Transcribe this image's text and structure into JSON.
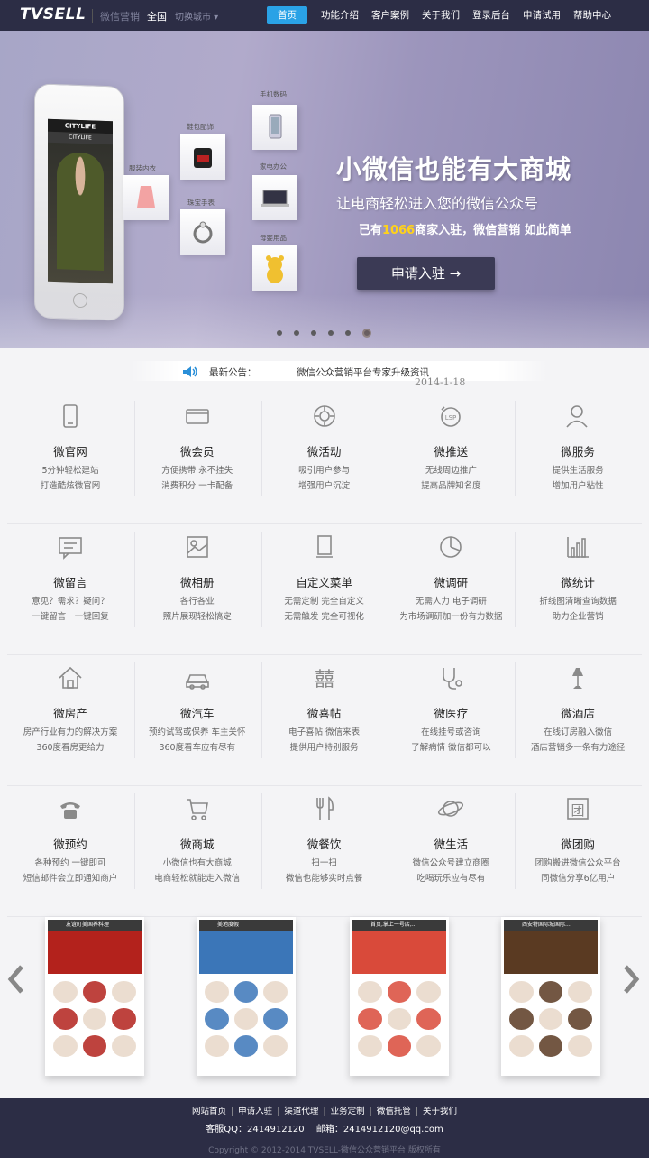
{
  "nav": {
    "logo": "TVSELL",
    "logo_sub": "微信营销",
    "city": "全国",
    "city_switch": "切换城市 ▾",
    "links": [
      "首页",
      "功能介绍",
      "客户案例",
      "关于我们",
      "登录后台",
      "申请试用",
      "帮助中心"
    ],
    "active_index": 0,
    "active_color": "#2aa2e6"
  },
  "banner": {
    "title": "小微信也能有大商城",
    "subtitle": "让电商轻松进入您的微信公众号",
    "line_prefix": "已有",
    "line_count": "1066",
    "line_suffix": "商家入驻，微信营销 如此简单",
    "cta": "申请入驻 →",
    "phone_title": "CITYLIFE",
    "categories": [
      "手机数码",
      "鞋包配饰",
      "服装内衣",
      "家电办公",
      "珠宝手表",
      "母婴用品"
    ],
    "slides": 6,
    "current_slide": 6
  },
  "notice": {
    "label": "最新公告：",
    "text": "微信公众营销平台专家升级资讯",
    "date": "2014-1-18"
  },
  "features": [
    [
      {
        "icon": "tablet-icon",
        "title": "微官网",
        "l1": "5分钟轻松建站",
        "l2": "打造酷炫微官网"
      },
      {
        "icon": "card-icon",
        "title": "微会员",
        "l1": "方便携带 永不挂失",
        "l2": "消费积分 一卡配备"
      },
      {
        "icon": "chip-icon",
        "title": "微活动",
        "l1": "吸引用户参与",
        "l2": "增强用户沉淀"
      },
      {
        "icon": "lsp-icon",
        "title": "微推送",
        "l1": "无线周边推广",
        "l2": "提高品牌知名度"
      },
      {
        "icon": "user-icon",
        "title": "微服务",
        "l1": "提供生活服务",
        "l2": "增加用户粘性"
      }
    ],
    [
      {
        "icon": "message-icon",
        "title": "微留言",
        "l1": "意见？需求？疑问？",
        "l2": "一键留言　一键回复"
      },
      {
        "icon": "image-icon",
        "title": "微相册",
        "l1": "各行各业",
        "l2": "照片展现轻松搞定"
      },
      {
        "icon": "menu-icon",
        "title": "自定义菜单",
        "l1": "无需定制 完全自定义",
        "l2": "无需触发 完全可视化"
      },
      {
        "icon": "pie-icon",
        "title": "微调研",
        "l1": "无需人力 电子调研",
        "l2": "为市场调研加一份有力数据"
      },
      {
        "icon": "bar-chart-icon",
        "title": "微统计",
        "l1": "折线图清晰查询数据",
        "l2": "助力企业营销"
      }
    ],
    [
      {
        "icon": "house-icon",
        "title": "微房产",
        "l1": "房产行业有力的解决方案",
        "l2": "360度看房更给力"
      },
      {
        "icon": "car-icon",
        "title": "微汽车",
        "l1": "预约试驾或保养 车主关怀",
        "l2": "360度看车应有尽有"
      },
      {
        "icon": "double-happiness-icon",
        "title": "微喜帖",
        "l1": "电子喜帖 微信来表",
        "l2": "提供用户特别服务"
      },
      {
        "icon": "stethoscope-icon",
        "title": "微医疗",
        "l1": "在线挂号或咨询",
        "l2": "了解病情 微信都可以"
      },
      {
        "icon": "lamp-icon",
        "title": "微酒店",
        "l1": "在线订房融入微信",
        "l2": "酒店营销多一条有力途径"
      }
    ],
    [
      {
        "icon": "telephone-icon",
        "title": "微预约",
        "l1": "各种预约 一键即可",
        "l2": "短信邮件会立即通知商户"
      },
      {
        "icon": "cart-icon",
        "title": "微商城",
        "l1": "小微信也有大商城",
        "l2": "电商轻松就能走入微信"
      },
      {
        "icon": "fork-knife-icon",
        "title": "微餐饮",
        "l1": "扫一扫",
        "l2": "微信也能够实时点餐"
      },
      {
        "icon": "planet-icon",
        "title": "微生活",
        "l1": "微信公众号建立商圈",
        "l2": "吃喝玩乐应有尽有"
      },
      {
        "icon": "group-buy-icon",
        "title": "微团购",
        "l1": "团购搬进微信公众平台",
        "l2": "同微信分享6亿用户"
      }
    ]
  ],
  "cases": [
    {
      "title": "友谊町美国养料理",
      "theme": "#b3221c"
    },
    {
      "title": "美地度假",
      "theme": "#3b76b8"
    },
    {
      "title": "首页,掌上一号店,...",
      "theme": "#d94a3a"
    },
    {
      "title": "西安特国际城国际...",
      "theme": "#5a3a22"
    }
  ],
  "footer": {
    "links": [
      "网站首页",
      "申请入驻",
      "渠道代理",
      "业务定制",
      "微信托管",
      "关于我们"
    ],
    "contact": "客服QQ：2414912120　 邮箱：2414912120@qq.com",
    "copyright": "Copyright © 2012-2014 TVSELL-微信公众营销平台 版权所有"
  }
}
